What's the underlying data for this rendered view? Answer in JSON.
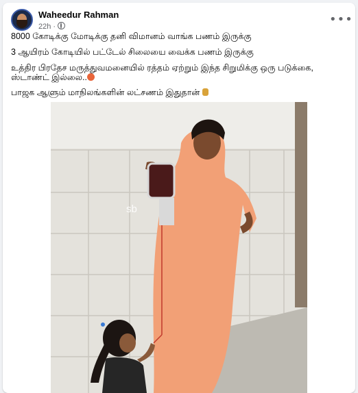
{
  "post": {
    "author": "Waheedur Rahman",
    "time": "22h",
    "separator": "·",
    "more_label": "•••",
    "lines": [
      "8000 கோடிக்கு மோடிக்கு தனி விமானம் வாங்க பணம் இருக்கு",
      "3 ஆயிரம் கோடியில் பட்டேல் சிலையை வைக்க பணம் இருக்கு",
      "உத்திர பிரதேச மருத்துவமனையில் ரத்தம் ஏற்றும் இந்த சிறுமிக்கு ஒரு படுக்கை, ஸ்டாண்ட் இல்லை..",
      "பாஜக ஆளும் மாநிலங்களின் லட்சணம் இதுதான்"
    ],
    "photo_watermark": "sb"
  },
  "icons": {
    "privacy": "globe-icon",
    "menu": "more-horizontal-icon",
    "emoji_1": "angry-face-icon",
    "emoji_2": "farmer-icon"
  },
  "colors": {
    "background": "#f0f2f5",
    "card": "#ffffff",
    "secondary_text": "#65676b"
  }
}
